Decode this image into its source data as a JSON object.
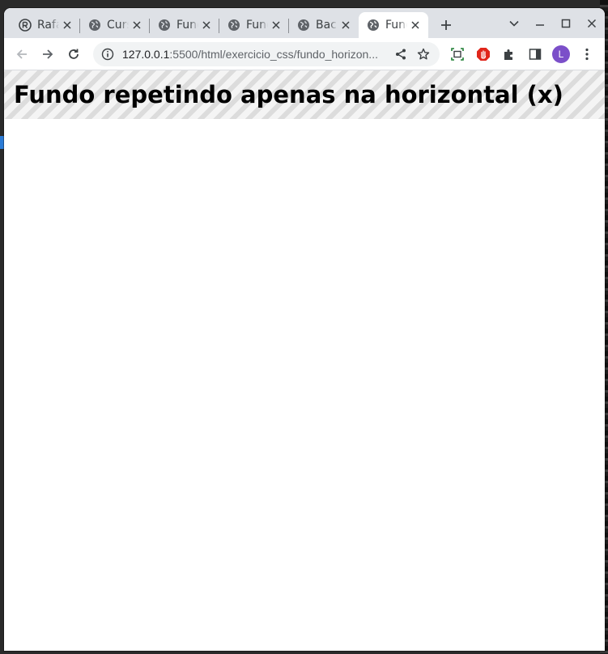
{
  "browser": {
    "tabs": [
      {
        "title": "Rafa",
        "icon": "github-icon",
        "active": false
      },
      {
        "title": "Curso",
        "icon": "globe-icon",
        "active": false
      },
      {
        "title": "Fundo",
        "icon": "globe-icon",
        "active": false
      },
      {
        "title": "Fundo",
        "icon": "globe-icon",
        "active": false
      },
      {
        "title": "Background",
        "icon": "globe-icon",
        "active": false
      },
      {
        "title": "Fundo",
        "icon": "globe-icon",
        "active": true
      }
    ],
    "address": {
      "host": "127.0.0.1",
      "path": ":5500/html/exercicio_css/fundo_horizon..."
    },
    "profile_initial": "L",
    "colors": {
      "tabstrip_bg": "#dee1e6",
      "avatar_bg": "#7b4fc9",
      "adblock_red": "#e0261b"
    }
  },
  "page": {
    "heading": "Fundo repetindo apenas na horizontal (x)"
  }
}
